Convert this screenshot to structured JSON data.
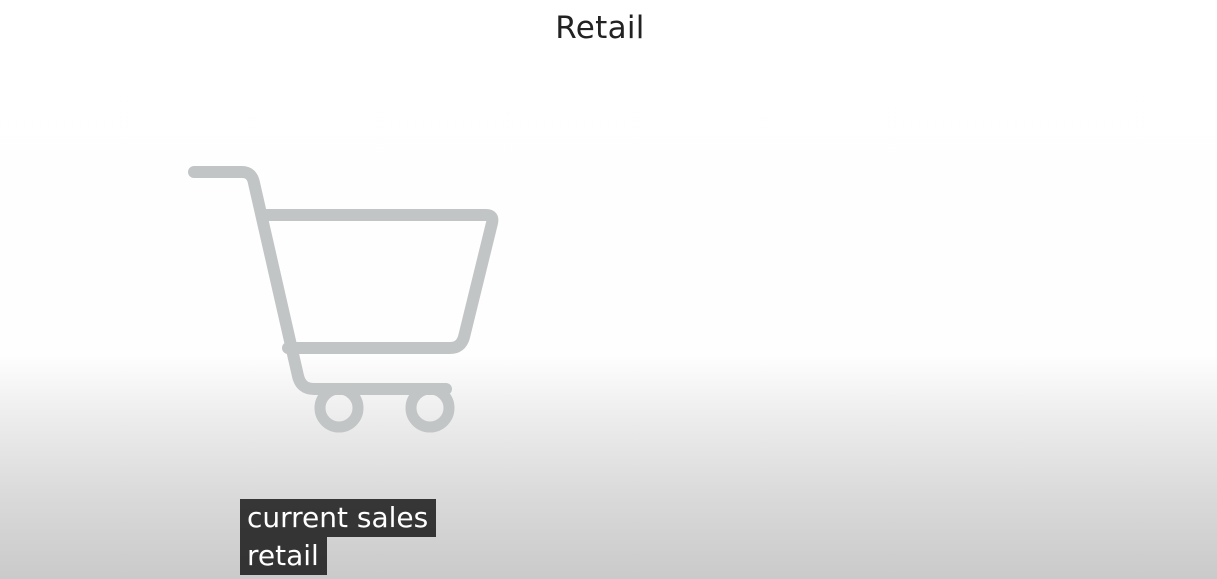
{
  "slide": {
    "title": "Retail",
    "icon": "shopping-cart-icon",
    "icon_color": "#c2c5c6"
  },
  "captions": {
    "line1": "current sales",
    "line2": "retail"
  }
}
